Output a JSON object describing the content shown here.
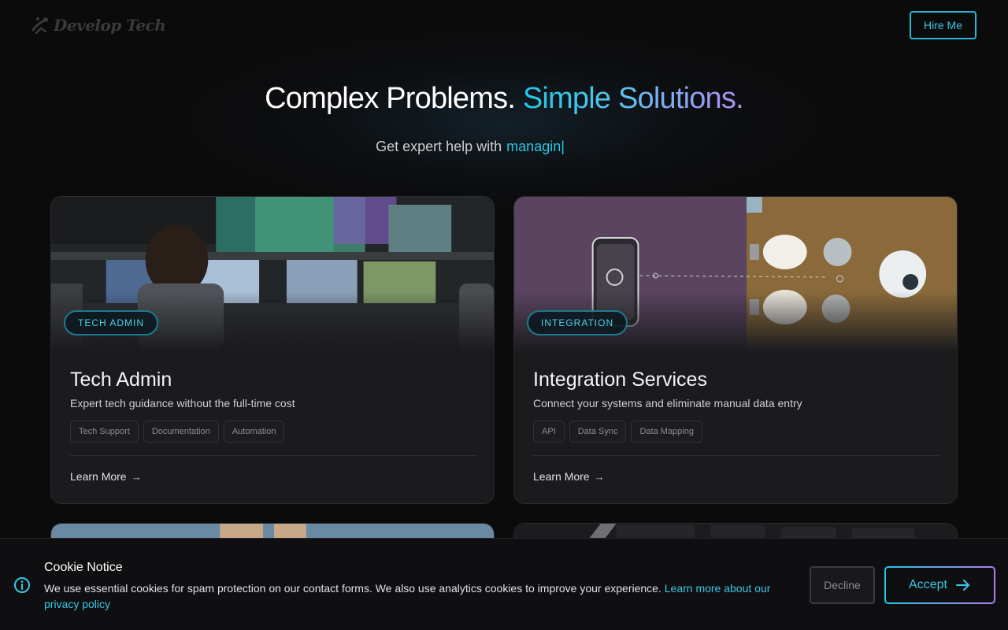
{
  "header": {
    "logo_text": "Develop Tech",
    "hire_label": "Hire Me"
  },
  "hero": {
    "title_plain": "Complex Problems.",
    "title_accent": "Simple Solutions.",
    "subtitle": "Get expert help with",
    "typed_text": "managin",
    "cursor": "|"
  },
  "cards": [
    {
      "badge": "TECH ADMIN",
      "title": "Tech Admin",
      "description": "Expert tech guidance without the full-time cost",
      "tags": [
        "Tech Support",
        "Documentation",
        "Automation"
      ],
      "link": "Learn More",
      "link_arrow": "→"
    },
    {
      "badge": "INTEGRATION",
      "title": "Integration Services",
      "description": "Connect your systems and eliminate manual data entry",
      "tags": [
        "API",
        "Data Sync",
        "Data Mapping"
      ],
      "link": "Learn More",
      "link_arrow": "→"
    }
  ],
  "cookie": {
    "title": "Cookie Notice",
    "text": "We use essential cookies for spam protection on our contact forms. We also use analytics cookies to improve your experience. ",
    "link": "Learn more about our privacy policy",
    "decline_label": "Decline",
    "accept_label": "Accept",
    "icon": "info-icon"
  },
  "colors": {
    "accent_cyan": "#22b8d6",
    "accent_purple": "#b07cf0",
    "background": "#0b0b0c",
    "card": "#1b1b1e"
  }
}
